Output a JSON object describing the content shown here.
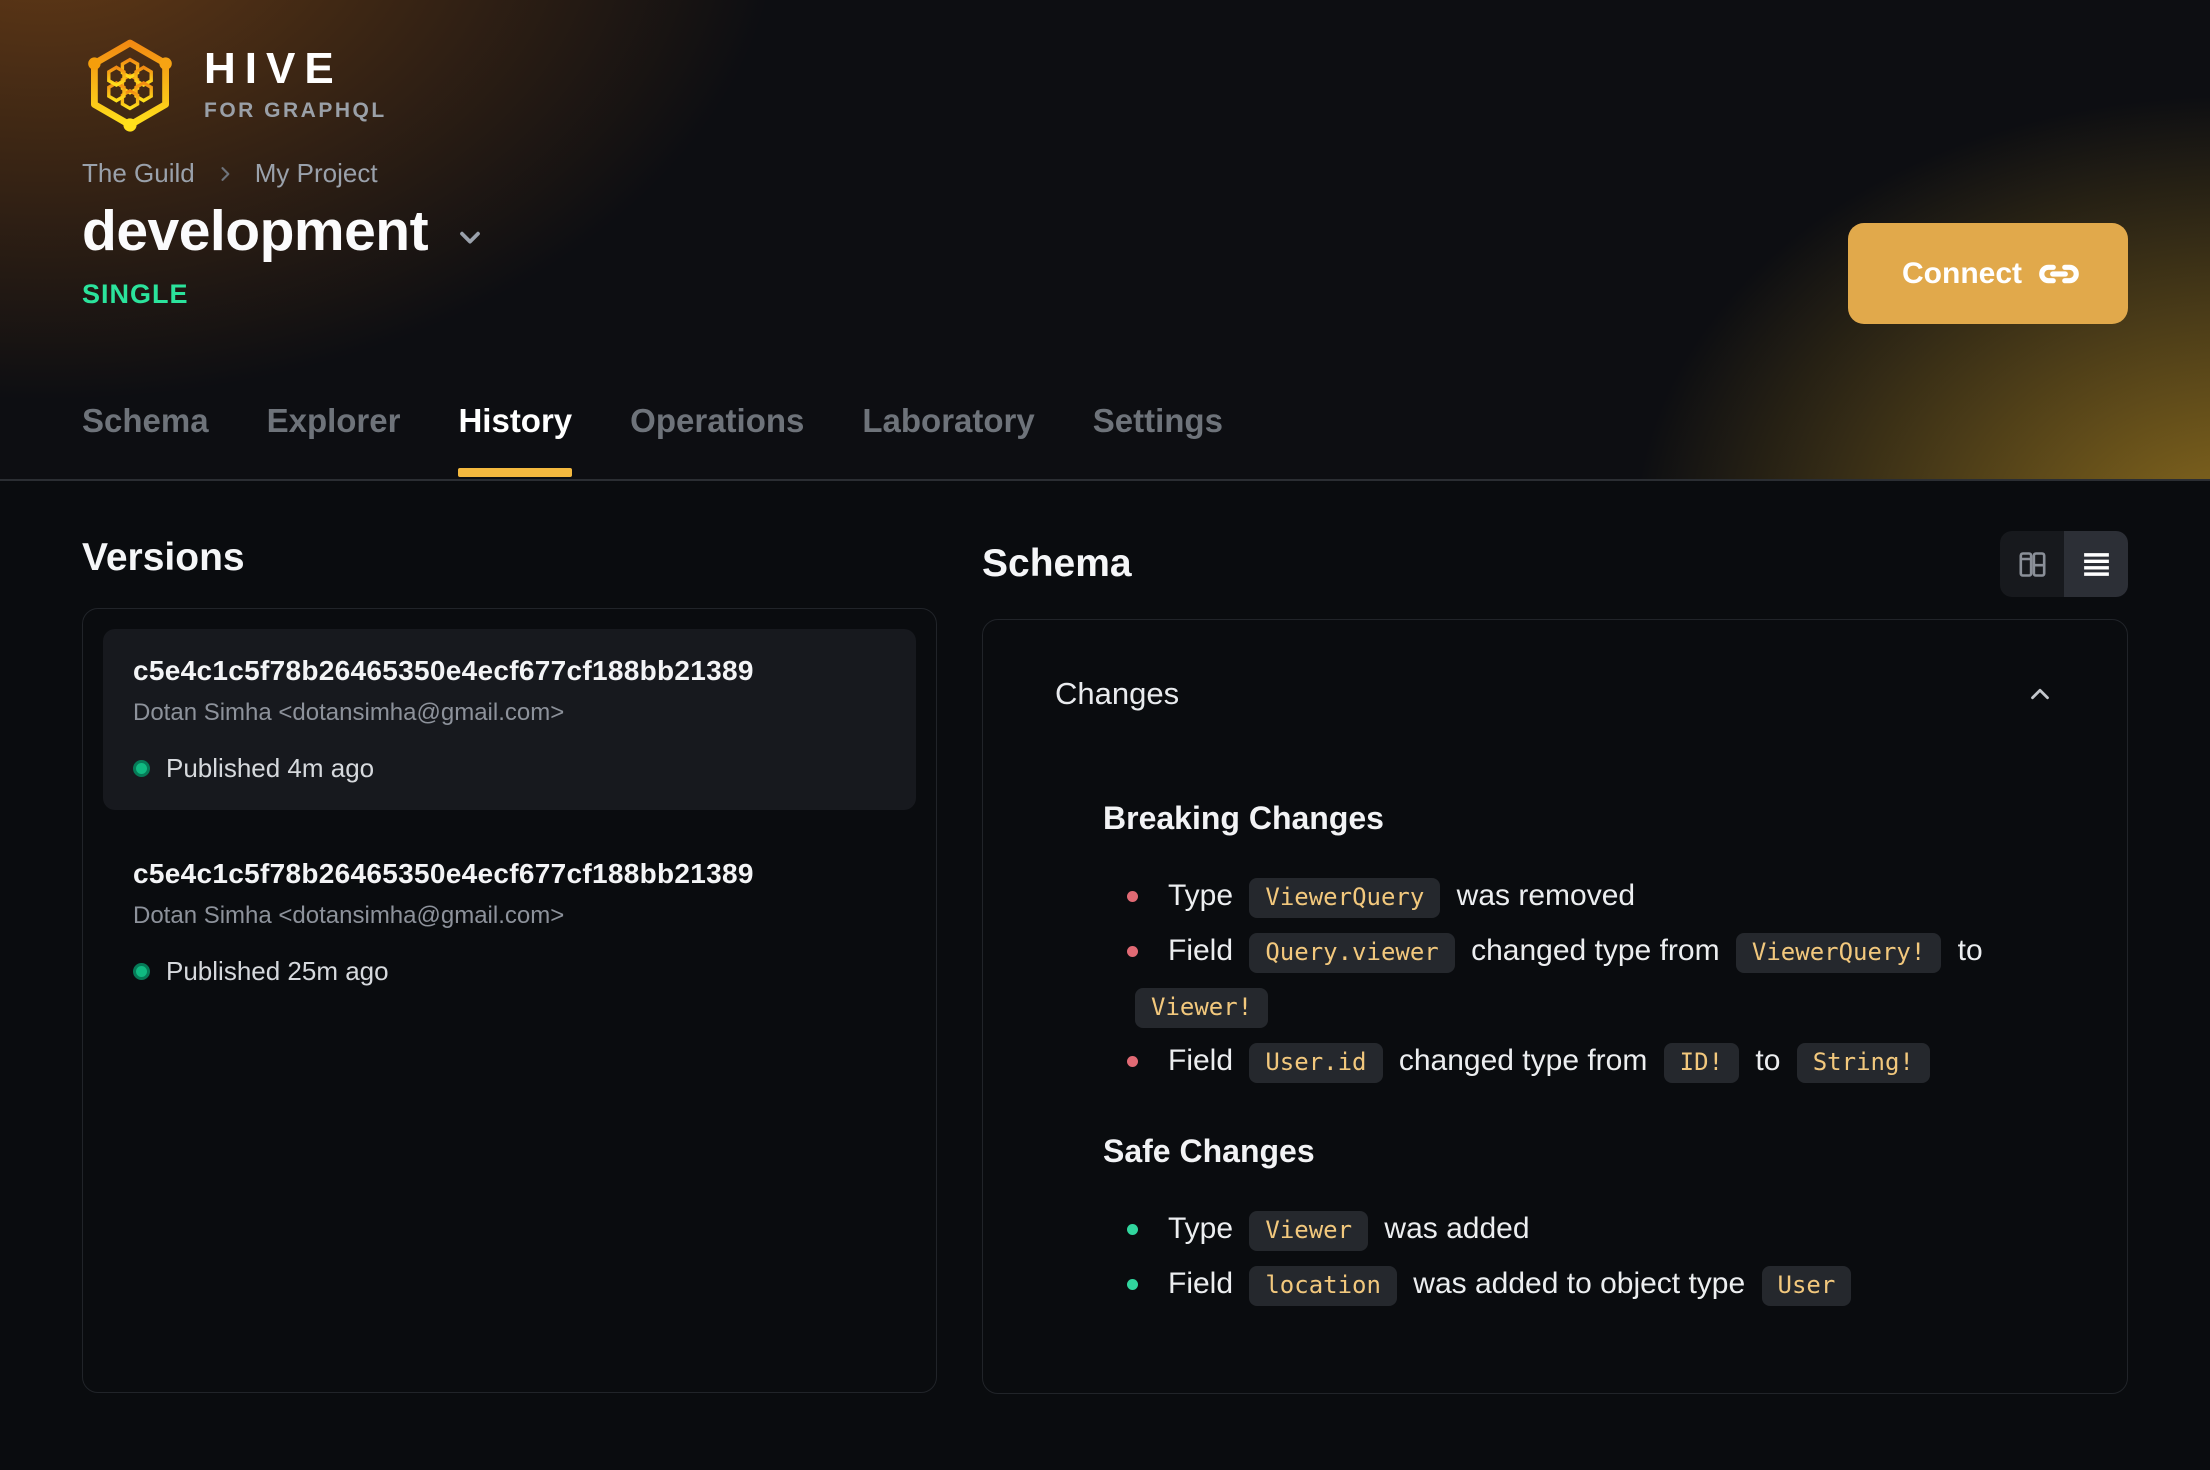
{
  "brand": {
    "name": "HIVE",
    "tagline": "FOR GRAPHQL"
  },
  "breadcrumb": {
    "items": [
      "The Guild",
      "My Project"
    ]
  },
  "target": {
    "name": "development",
    "badge": "SINGLE"
  },
  "connect": {
    "label": "Connect"
  },
  "tabs": [
    {
      "label": "Schema",
      "active": false
    },
    {
      "label": "Explorer",
      "active": false
    },
    {
      "label": "History",
      "active": true
    },
    {
      "label": "Operations",
      "active": false
    },
    {
      "label": "Laboratory",
      "active": false
    },
    {
      "label": "Settings",
      "active": false
    }
  ],
  "versions": {
    "title": "Versions",
    "items": [
      {
        "hash": "c5e4c1c5f78b26465350e4ecf677cf188bb21389",
        "author": "Dotan Simha <dotansimha@gmail.com>",
        "status": "Published 4m ago",
        "selected": true
      },
      {
        "hash": "c5e4c1c5f78b26465350e4ecf677cf188bb21389",
        "author": "Dotan Simha <dotansimha@gmail.com>",
        "status": "Published 25m ago",
        "selected": false
      }
    ]
  },
  "schema": {
    "title": "Schema",
    "view_toggle": {
      "options": [
        "columns-view",
        "list-view"
      ],
      "selected": "list-view"
    },
    "changes": {
      "title": "Changes",
      "collapsed": false,
      "sections": [
        {
          "heading": "Breaking Changes",
          "kind": "breaking",
          "items": [
            [
              {
                "text": "Type "
              },
              {
                "code": "ViewerQuery"
              },
              {
                "text": " was removed"
              }
            ],
            [
              {
                "text": "Field "
              },
              {
                "code": "Query.viewer"
              },
              {
                "text": " changed type from "
              },
              {
                "code": "ViewerQuery!"
              },
              {
                "text": " to "
              },
              {
                "code": "Viewer!"
              }
            ],
            [
              {
                "text": "Field "
              },
              {
                "code": "User.id"
              },
              {
                "text": " changed type from "
              },
              {
                "code": "ID!"
              },
              {
                "text": " to "
              },
              {
                "code": "String!"
              }
            ]
          ]
        },
        {
          "heading": "Safe Changes",
          "kind": "safe",
          "items": [
            [
              {
                "text": "Type "
              },
              {
                "code": "Viewer"
              },
              {
                "text": " was added"
              }
            ],
            [
              {
                "text": "Field "
              },
              {
                "code": "location"
              },
              {
                "text": " was added to object type "
              },
              {
                "code": "User"
              }
            ]
          ]
        }
      ]
    }
  },
  "icons": {
    "logo": "hive-hexagon-logo",
    "breadcrumb_separator": "chevron-right-icon",
    "target_selector": "chevron-down-icon",
    "connect": "link-icon",
    "view_columns": "columns-icon",
    "view_list": "list-icon",
    "changes_collapse": "chevron-up-icon",
    "version_status": "green-dot-icon"
  },
  "colors": {
    "accent_gold": "#f4b93f",
    "connect_gold": "#e1a94b",
    "badge_green": "#2be39c",
    "published_green": "#10b981",
    "breaking_red": "#e16a74",
    "safe_green": "#31d69e",
    "chip_text": "#f2c87d",
    "chip_bg": "#25282d"
  }
}
